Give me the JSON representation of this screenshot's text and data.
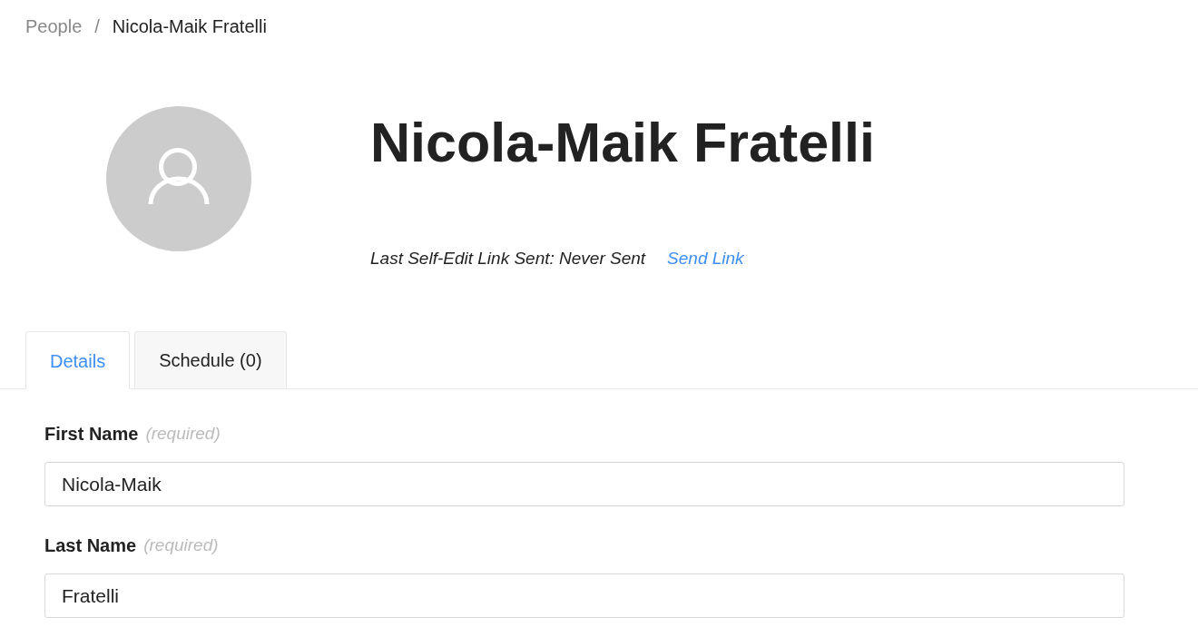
{
  "breadcrumb": {
    "separator": "/",
    "items": [
      {
        "label": "People",
        "current": false
      },
      {
        "label": "Nicola-Maik Fratelli",
        "current": true
      }
    ]
  },
  "profile": {
    "name": "Nicola-Maik Fratelli",
    "self_edit_status": "Last Self-Edit Link Sent: Never Sent",
    "send_link": "Send Link"
  },
  "tabs": [
    {
      "label": "Details",
      "selected": true
    },
    {
      "label": "Schedule (0)",
      "selected": false
    }
  ],
  "fields": [
    {
      "label": "First Name",
      "hint": "(required)",
      "value": "Nicola-Maik"
    },
    {
      "label": "Last Name",
      "hint": "(required)",
      "value": "Fratelli"
    }
  ]
}
